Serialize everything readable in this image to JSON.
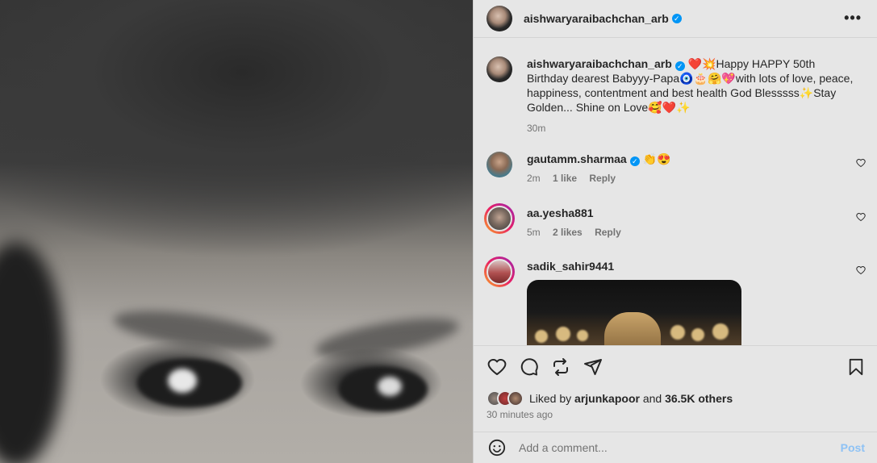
{
  "post": {
    "author": "aishwaryaraibachchan_arb",
    "caption_text": "❤️💥Happy HAPPY 50th Birthday dearest Babyyy-Papa🧿🎂🤗💖with lots of love, peace, happiness, contentment and best health God Blesssss✨Stay Golden... Shine on Love🥰❤️✨",
    "caption_time": "30m"
  },
  "comments": [
    {
      "user": "gautamm.sharmaa",
      "verified": true,
      "text": "👏😍",
      "time": "2m",
      "likes": "1 like",
      "reply": "Reply"
    },
    {
      "user": "aa.yesha881",
      "verified": false,
      "text": "",
      "time": "5m",
      "likes": "2 likes",
      "reply": "Reply"
    },
    {
      "user": "sadik_sahir9441",
      "verified": false,
      "text": ""
    }
  ],
  "likes": {
    "prefix": "Liked by",
    "user": "arjunkapoor",
    "conj": "and",
    "others": "36.5K others"
  },
  "posted_time": "30 minutes ago",
  "composer": {
    "placeholder": "Add a comment...",
    "post_label": "Post"
  },
  "colors": {
    "verified": "#0095f6",
    "post_button": "#8ec2f5",
    "muted_text": "#737373"
  }
}
